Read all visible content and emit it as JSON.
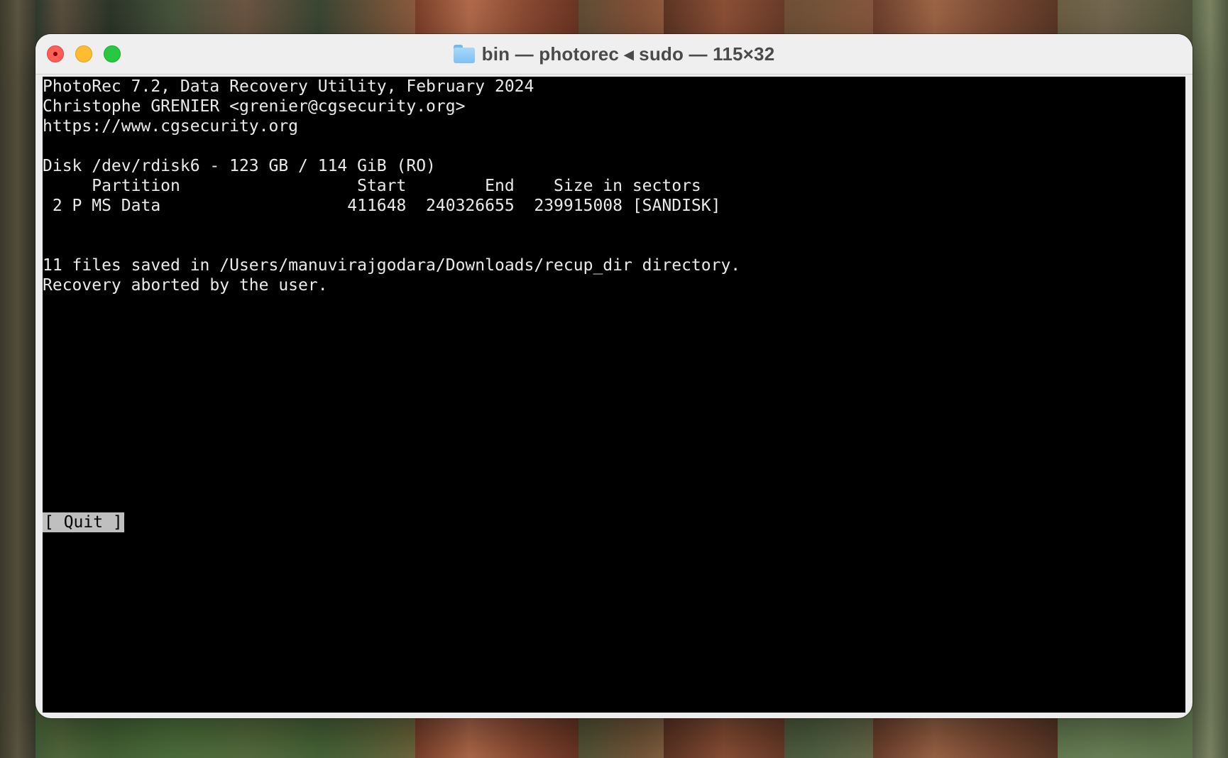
{
  "window": {
    "title": "bin — photorec ◂ sudo — 115×32"
  },
  "terminal": {
    "lines": [
      "PhotoRec 7.2, Data Recovery Utility, February 2024",
      "Christophe GRENIER <grenier@cgsecurity.org>",
      "https://www.cgsecurity.org",
      "",
      "Disk /dev/rdisk6 - 123 GB / 114 GiB (RO)",
      "     Partition                  Start        End    Size in sectors",
      " 2 P MS Data                   411648  240326655  239915008 [SANDISK]",
      "",
      "",
      "11 files saved in /Users/manuvirajgodara/Downloads/recup_dir directory.",
      "Recovery aborted by the user."
    ],
    "quit_button": "[ Quit ]"
  },
  "colors": {
    "terminal_background": "#000000",
    "terminal_text": "#eaeaea",
    "selection_background": "#bfbfbf",
    "close_button": "#ff5f57",
    "minimize_button": "#febc2e",
    "zoom_button": "#28c840"
  },
  "icons": {
    "title": "folder-icon"
  }
}
